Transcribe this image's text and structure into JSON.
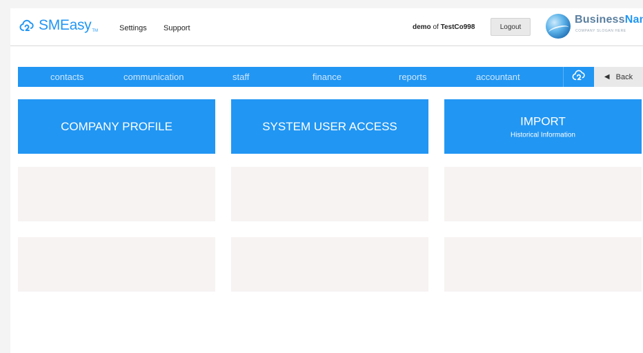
{
  "header": {
    "logo_text": "SMEasy",
    "logo_tm": "TM",
    "nav": [
      {
        "label": "Settings"
      },
      {
        "label": "Support"
      }
    ],
    "user": {
      "name": "demo",
      "of": "of",
      "company": "TestCo998"
    },
    "logout_label": "Logout",
    "business": {
      "name_part1": "Business",
      "name_part2": "Name",
      "tagline": "COMPANY SLOGAN HERE"
    }
  },
  "menu": {
    "items": [
      {
        "label": "contacts"
      },
      {
        "label": "communication"
      },
      {
        "label": "staff"
      },
      {
        "label": "finance"
      },
      {
        "label": "reports"
      },
      {
        "label": "accountant"
      }
    ],
    "back_label": "Back"
  },
  "tiles": [
    {
      "title": "COMPANY PROFILE",
      "subtitle": ""
    },
    {
      "title": "SYSTEM USER ACCESS",
      "subtitle": ""
    },
    {
      "title": "IMPORT",
      "subtitle": "Historical Information"
    }
  ],
  "colors": {
    "accent": "#2196f3",
    "menu_text": "#cfe7fc",
    "empty_tile": "#f6f3f2",
    "back_button": "#e9e9e9"
  },
  "icons": {
    "logo": "cloud-icon",
    "home": "cloud-icon",
    "back": "triangle-left-icon"
  }
}
